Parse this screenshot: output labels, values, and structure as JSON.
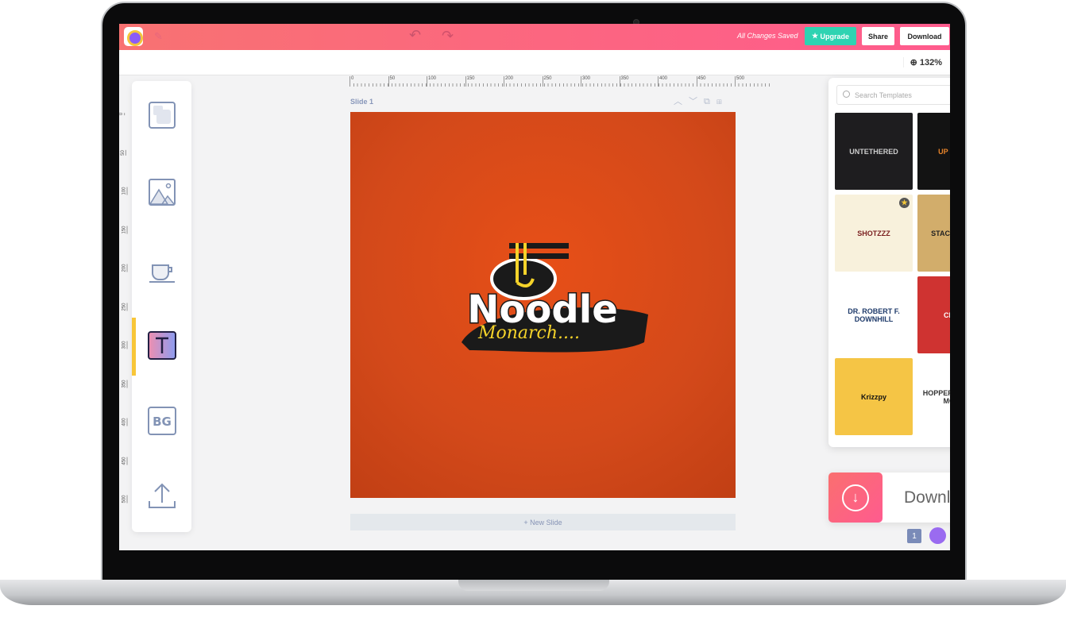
{
  "header": {
    "saved_status": "All Changes Saved",
    "upgrade_label": "Upgrade",
    "share_label": "Share",
    "download_label": "Download"
  },
  "zoom_level": "132%",
  "ruler": {
    "horizontal": [
      "0",
      "50",
      "100",
      "150",
      "200",
      "250",
      "300",
      "350",
      "400",
      "450",
      "500"
    ],
    "vertical": [
      "0",
      "50",
      "100",
      "150",
      "200",
      "250",
      "300",
      "350",
      "400",
      "450",
      "500"
    ]
  },
  "tools": [
    {
      "name": "elements-icon"
    },
    {
      "name": "image-icon"
    },
    {
      "name": "graphics-icon"
    },
    {
      "name": "text-icon",
      "active": true
    },
    {
      "name": "background-icon",
      "label": "BG"
    },
    {
      "name": "upload-icon"
    }
  ],
  "slide": {
    "label": "Slide 1",
    "new_slide_label": "+ New Slide",
    "background": "#db4a17",
    "logo": {
      "title": "Noodle",
      "subtitle": "Monarch...."
    }
  },
  "templates": {
    "search_placeholder": "Search Templates",
    "items": [
      {
        "label": "UNTETHERED",
        "bg": "#1e1d1f",
        "color": "#ccc"
      },
      {
        "label": "UP WE GO",
        "bg": "#131313",
        "color": "#e8842a"
      },
      {
        "label": "SHOTZZZ",
        "bg": "#f8f1dc",
        "color": "#7a1f1f",
        "premium": true
      },
      {
        "label": "STACEY & KIM",
        "bg": "#d2ad6b",
        "color": "#222"
      },
      {
        "label": "DR. ROBERT F. DOWNHILL",
        "bg": "#ffffff",
        "color": "#1e3a6a"
      },
      {
        "label": "CELOO",
        "bg": "#cf3331",
        "color": "#fff"
      },
      {
        "label": "Krizzpy",
        "bg": "#f5c545",
        "color": "#111"
      },
      {
        "label": "HOPPER | RAISER | MCGEE",
        "bg": "#ffffff",
        "color": "#333"
      }
    ]
  },
  "download_card": {
    "label": "Download"
  },
  "page_count": "1"
}
